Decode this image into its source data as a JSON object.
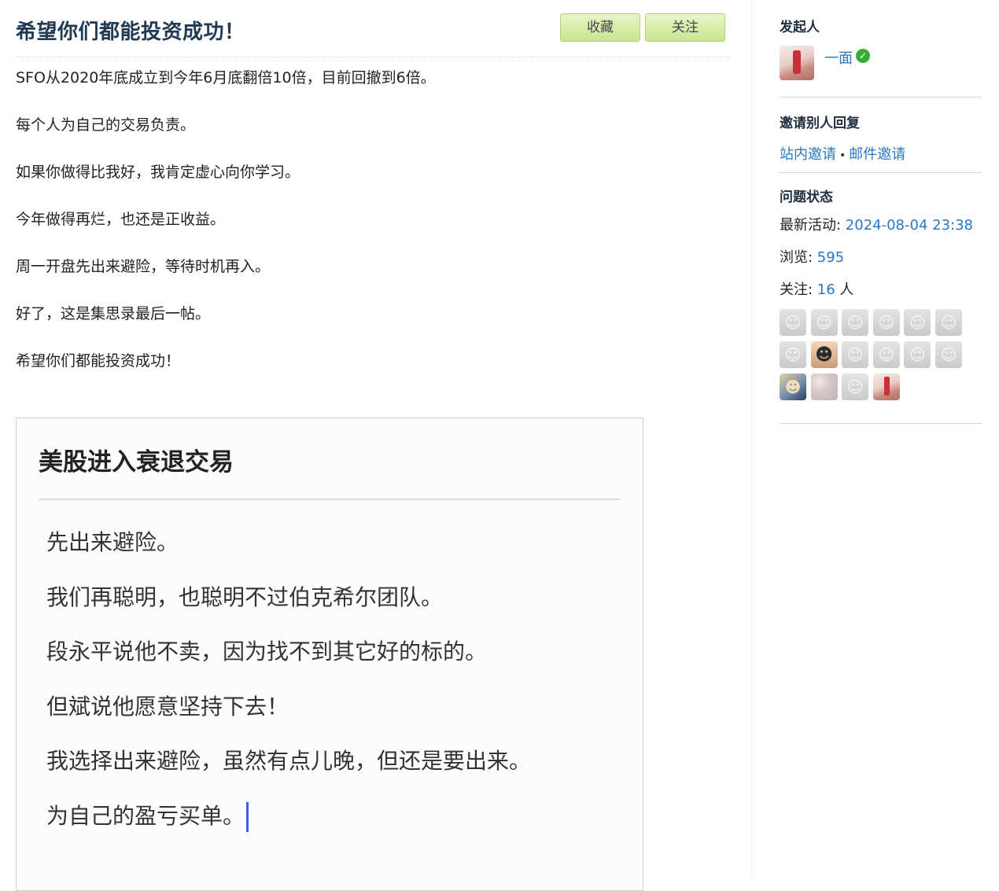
{
  "question": {
    "title": "希望你们都能投资成功！",
    "buttons": {
      "favorite": "收藏",
      "follow": "关注"
    },
    "paragraphs": [
      "SFO从2020年底成立到今年6月底翻倍10倍，目前回撤到6倍。",
      "每个人为自己的交易负责。",
      "如果你做得比我好，我肯定虚心向你学习。",
      "今年做得再烂，也还是正收益。",
      "周一开盘先出来避险，等待时机再入。",
      "好了，这是集思录最后一帖。",
      "希望你们都能投资成功！"
    ]
  },
  "embedded_image": {
    "title": "美股进入衰退交易",
    "lines": [
      "先出来避险。",
      "我们再聪明，也聪明不过伯克希尔团队。",
      "段永平说他不卖，因为找不到其它好的标的。",
      "但斌说他愿意坚持下去！",
      "我选择出来避险，虽然有点儿晚，但还是要出来。",
      "为自己的盈亏买单。"
    ]
  },
  "sidebar": {
    "initiator": {
      "title": "发起人",
      "username": "一面",
      "verified_icon": "verified-check-icon",
      "verified_glyph": "✓"
    },
    "invite": {
      "title": "邀请别人回复",
      "onsite": "站内邀请",
      "separator": "•",
      "email": "邮件邀请"
    },
    "status": {
      "title": "问题状态",
      "activity_label": "最新活动: ",
      "activity_value": "2024-08-04 23:38",
      "views_label": "浏览: ",
      "views_value": "595",
      "followers_label": "关注: ",
      "followers_value": "16",
      "followers_unit": " 人",
      "follower_avatars": [
        "default-avatar",
        "default-avatar",
        "default-avatar",
        "default-avatar",
        "default-avatar",
        "default-avatar",
        "default-avatar",
        "cartoon-face-avatar",
        "default-avatar",
        "default-avatar",
        "default-avatar",
        "default-avatar",
        "man-photo-avatar",
        "white-texture-avatar",
        "default-avatar",
        "red-figure-avatar"
      ]
    }
  }
}
